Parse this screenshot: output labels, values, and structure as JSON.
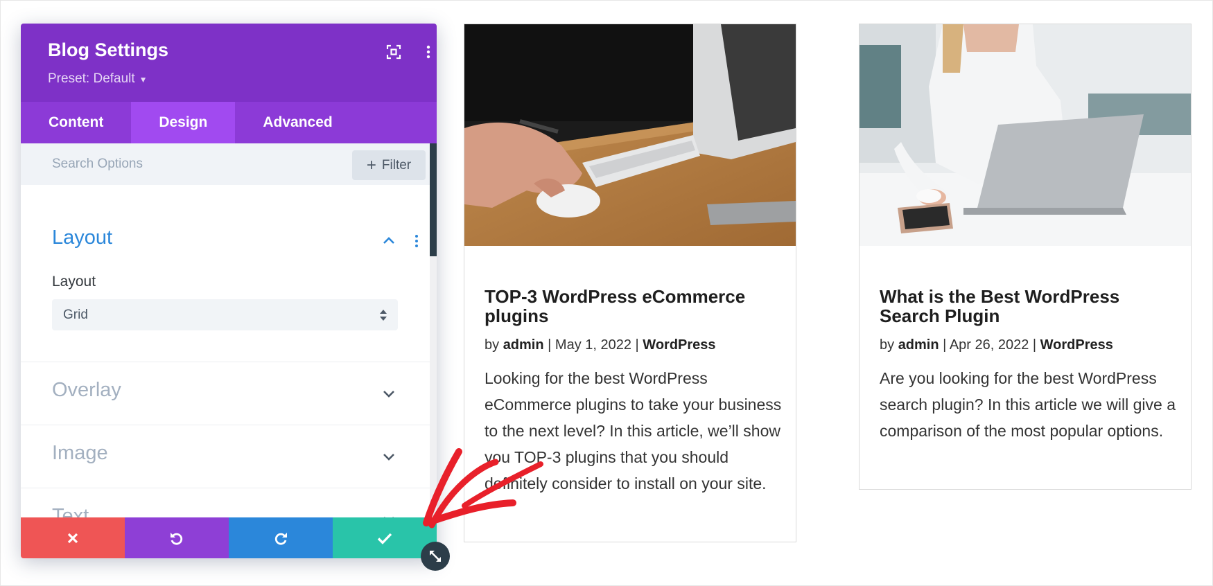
{
  "panel": {
    "title": "Blog Settings",
    "preset": "Preset: Default",
    "header_icons": [
      "expand-icon",
      "more-vertical-icon"
    ],
    "tabs": [
      {
        "label": "Content",
        "active": false
      },
      {
        "label": "Design",
        "active": true
      },
      {
        "label": "Advanced",
        "active": false
      }
    ],
    "search_placeholder": "Search Options",
    "filter_label": "Filter",
    "toggles": {
      "layout": {
        "title": "Layout",
        "field_label": "Layout",
        "select_value": "Grid"
      },
      "overlay": {
        "title": "Overlay"
      },
      "image": {
        "title": "Image"
      },
      "text": {
        "title": "Text"
      }
    },
    "actions": [
      {
        "name": "discard",
        "icon": "close-icon",
        "color": "#ef5555"
      },
      {
        "name": "undo",
        "icon": "undo-icon",
        "color": "#8e3fd6"
      },
      {
        "name": "redo",
        "icon": "redo-icon",
        "color": "#2b87da"
      },
      {
        "name": "save",
        "icon": "check-icon",
        "color": "#29c4a9"
      }
    ],
    "colors": {
      "header": "#7e31c7",
      "tab_active": "#a14af0",
      "accent_blue": "#2b87da"
    }
  },
  "posts": [
    {
      "title": "TOP-3 WordPress eCommerce plugins",
      "meta_prefix": "by ",
      "author": "admin",
      "date": "May 1, 2022",
      "category": "WordPress",
      "excerpt": "Looking for the best WordPress eCommerce plugins to take your business to the next level? In this article, we’ll show you TOP-3 plugins that you should definitely consider to install on your site."
    },
    {
      "title": "What is the Best WordPress Search Plugin",
      "meta_prefix": "by ",
      "author": "admin",
      "date": "Apr 26, 2022",
      "category": "WordPress",
      "excerpt": "Are you looking for the best WordPress search plugin? In this article we will give a comparison of the most popular options."
    }
  ],
  "annotation": {
    "color": "#e8202a"
  }
}
